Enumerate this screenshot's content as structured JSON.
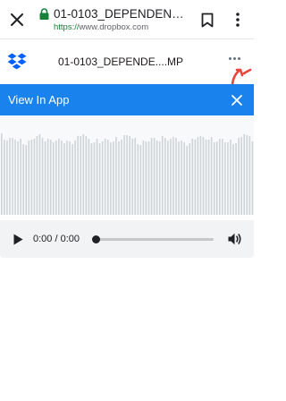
{
  "browser": {
    "title": "01-0103_DEPENDENT_O...",
    "url_scheme": "https://",
    "url_host": "www.dropbox.com",
    "icons": [
      "close-icon",
      "lock-icon",
      "bookmark-icon",
      "more-vertical-icon"
    ]
  },
  "dropbox_header": {
    "filename": "01-0103_DEPENDE....MP",
    "icons": [
      "dropbox-logo",
      "more-horizontal-icon"
    ],
    "colors": {
      "logo": "#0061fe",
      "annotation": "#e8453c"
    }
  },
  "banner": {
    "label": "View In App",
    "icons": [
      "close-icon"
    ],
    "colors": {
      "background": "#1a82ed",
      "text": "#ffffff"
    }
  },
  "player": {
    "time": "0:00 / 0:00",
    "progress": 0,
    "icons": [
      "play-icon",
      "volume-icon"
    ]
  }
}
